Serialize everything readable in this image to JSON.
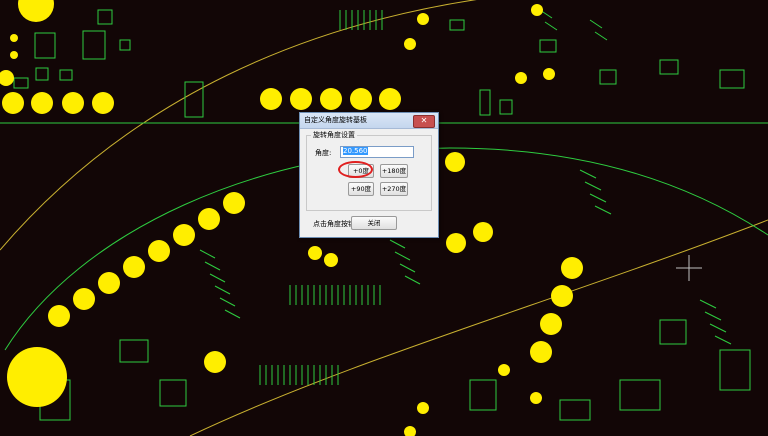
{
  "dialog": {
    "title": "自定义角度旋转基板",
    "group_label": "旋转角度设置",
    "angle_label": "角度:",
    "angle_value": "20.560",
    "btn_0": "+0度",
    "btn_90": "+90度",
    "btn_180": "+180度",
    "btn_270": "+270度",
    "hint": "点击角度按钮旋转",
    "close_label": "关闭"
  },
  "colors": {
    "background": "#120606",
    "trace": "#2ecc40",
    "pad": "#ffee00",
    "outline": "#d4b830",
    "highlight": "#e02020"
  }
}
